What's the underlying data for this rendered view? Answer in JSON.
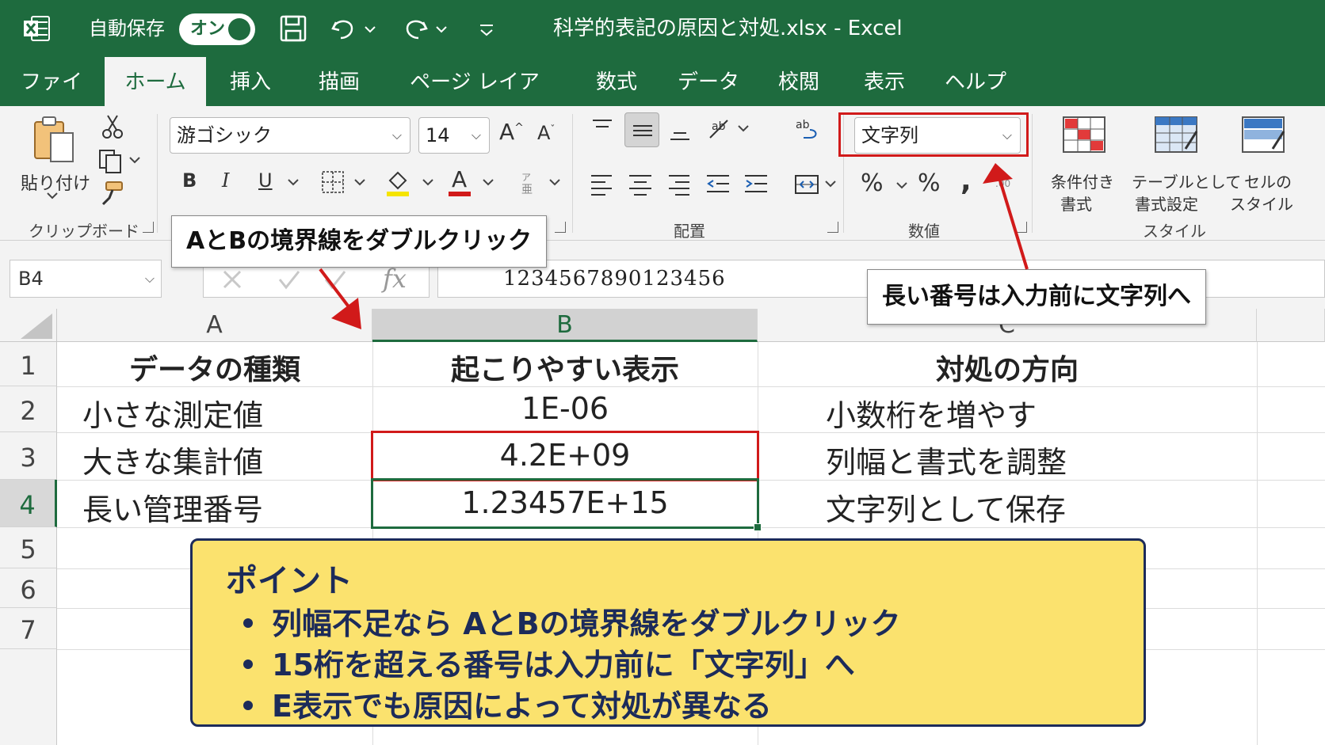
{
  "titlebar": {
    "autosave_label": "自動保存",
    "toggle_label": "オン",
    "document_title": "科学的表記の原因と対処.xlsx  -  Excel"
  },
  "tabs": [
    "ファイル",
    "ホーム",
    "挿入",
    "描画",
    "ページ レイアウト",
    "数式",
    "データ",
    "校閲",
    "表示",
    "ヘルプ"
  ],
  "active_tab": "ホーム",
  "ribbon": {
    "clipboard": {
      "paste_label": "貼り付け",
      "group_label": "クリップボード"
    },
    "font": {
      "name": "游ゴシック",
      "size": "14",
      "bold": "B",
      "italic": "I",
      "underline": "U"
    },
    "alignment": {
      "group_label": "配置"
    },
    "number": {
      "format": "文字列",
      "percent1": "%",
      "percent2": "%",
      "comma": ",",
      "group_label": "数値"
    },
    "styles": {
      "conditional_line1": "条件付き",
      "conditional_line2": "書式",
      "table_line1": "テーブルとして",
      "table_line2": "書式設定",
      "cell_line1": "セルの",
      "cell_line2": "スタイル",
      "group_label": "スタイル"
    }
  },
  "formula_bar": {
    "name_box": "B4",
    "fx": "fx",
    "value": "1234567890123456"
  },
  "grid": {
    "columns": [
      "A",
      "B",
      "C"
    ],
    "selected_column": "B",
    "rows": [
      "1",
      "2",
      "3",
      "4",
      "5",
      "6",
      "7"
    ],
    "selected_row": "4",
    "cells": [
      [
        "データの種類",
        "起こりやすい表示",
        "対処の方向"
      ],
      [
        "小さな測定値",
        "1E-06",
        "小数桁を増やす"
      ],
      [
        "大きな集計値",
        "4.2E+09",
        "列幅と書式を調整"
      ],
      [
        "長い管理番号",
        "1.23457E+15",
        "文字列として保存"
      ]
    ]
  },
  "callouts": {
    "border": "AとBの境界線をダブルクリック",
    "text_format": "長い番号は入力前に文字列へ"
  },
  "point": {
    "title": "ポイント",
    "items": [
      "列幅不足なら AとBの境界線をダブルクリック",
      "15桁を超える番号は入力前に「文字列」へ",
      "E表示でも原因によって対処が異なる"
    ]
  },
  "colors": {
    "excel_green": "#1e6b3e",
    "highlight_red": "#d11a1a",
    "point_fill": "#fbe26e",
    "point_border": "#1c2b5a"
  }
}
